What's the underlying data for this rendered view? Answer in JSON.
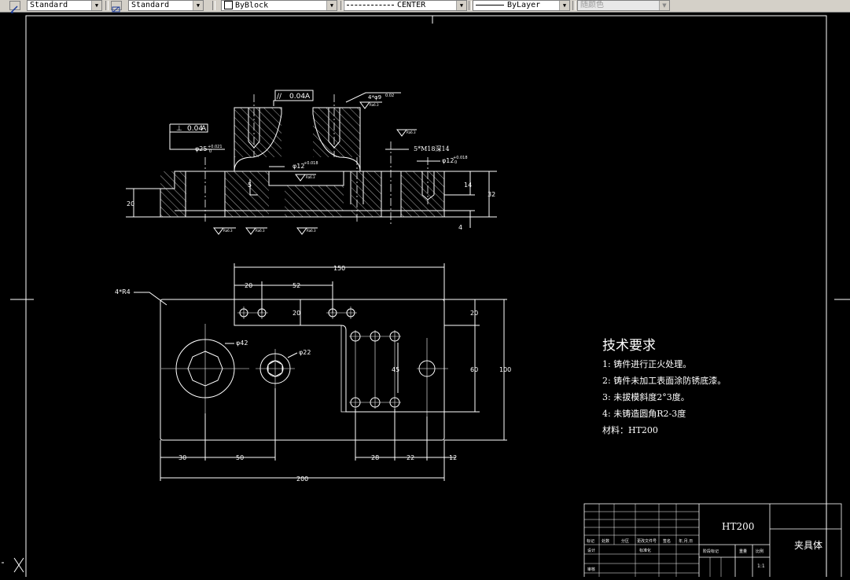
{
  "toolbar": {
    "text_style": "Standard",
    "dim_style": "Standard",
    "color": "ByBlock",
    "linetype": "CENTER",
    "lineweight": "ByLayer",
    "plot_style": "随颜色"
  },
  "drawing": {
    "tolerances": {
      "parallel_value": "0.04",
      "parallel_datum": "A",
      "perp_value": "0.04",
      "perp_datum": "A",
      "parallel_symbol": "//",
      "perp_symbol": "⊥"
    },
    "section_labels": {
      "holes_top": "4*φ9",
      "holes_top_depth": "0.02",
      "bore_left": "φ25",
      "bore_left_tol": "+0.021",
      "bore_left_tol_low": "0",
      "bore_mid": "φ12",
      "bore_mid_tol": "+0.018",
      "bore_right": "φ12",
      "bore_right_tol": "+0.018",
      "bore_right_tol_low": "0",
      "thread": "5*M18深14",
      "dim_20": "20",
      "dim_5": "5",
      "dim_14": "14",
      "dim_32": "32",
      "dim_4": "4",
      "roughness": "Ra6.3"
    },
    "plan_labels": {
      "radius_note": "4*R4",
      "dia_42": "φ42",
      "dia_22": "φ22",
      "d150": "150",
      "d20a": "20",
      "d52": "52",
      "d20b": "20",
      "d20c": "20",
      "d60": "60",
      "d100": "100",
      "d45": "45",
      "d30": "30",
      "d50": "50",
      "d28": "28",
      "d22": "22",
      "d12": "12",
      "d200": "200"
    },
    "requirements": {
      "title": "技术要求",
      "items": [
        "1:  铸件进行正火处理。",
        "2:  铸件未加工表面涂防锈底漆。",
        "3:  未拔模斜度2°3度。",
        "4:  未铸造圆角R2-3度",
        "材料：HT200"
      ]
    },
    "title_block": {
      "material": "HT200",
      "part_name": "夹具体",
      "scale": "1:1",
      "headers": [
        "标记",
        "处数",
        "分区",
        "更改文件号",
        "签名",
        "年,月,日"
      ],
      "row_labels": [
        "设计",
        "审核"
      ],
      "mid_labels": [
        "标准化"
      ],
      "right_headers": [
        "阶段标记",
        "重量",
        "比例"
      ]
    }
  }
}
